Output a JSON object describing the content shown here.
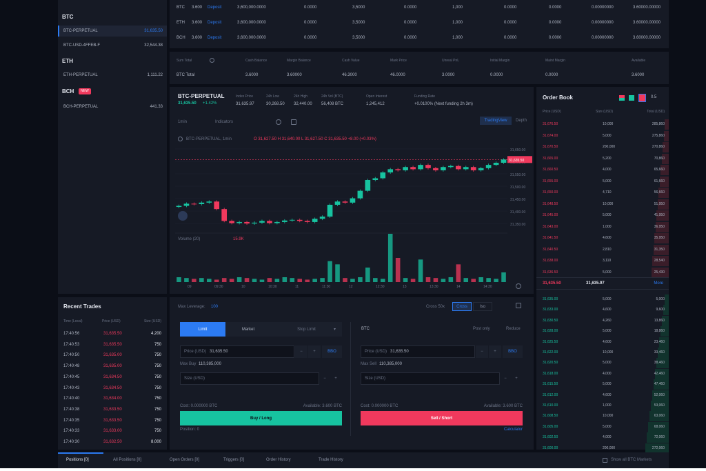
{
  "left_sidebar": {
    "sections": [
      {
        "title": "BTC",
        "items": [
          {
            "name": "BTC-PERPETUAL",
            "value": "31,635.50",
            "active": true
          },
          {
            "name": "BTC-USD-4FFEB-F",
            "value": "32,544.38",
            "active": false
          }
        ]
      },
      {
        "title": "ETH",
        "items": [
          {
            "name": "ETH-PERPETUAL",
            "value": "1,111.22",
            "active": false
          }
        ]
      },
      {
        "title": "BCH",
        "badge": "NEW",
        "items": [
          {
            "name": "BCH-PERPETUAL",
            "value": "441.33",
            "active": false
          }
        ]
      }
    ]
  },
  "top_table": {
    "rows": [
      {
        "asset": "BTC",
        "amount": "3.600",
        "action": "Deposit",
        "v1": "3,600,000.0000",
        "v2": "0.0000",
        "v3": "3,5000",
        "v4": "0.0000",
        "v5": "1,000",
        "v6": "0.0000",
        "v7": "0.0000",
        "v8": "0.00000000",
        "v9": "3.60000.00000"
      },
      {
        "asset": "ETH",
        "amount": "3.600",
        "action": "Deposit",
        "v1": "3,600,000.0000",
        "v2": "0.0000",
        "v3": "3,5000",
        "v4": "0.0000",
        "v5": "1,000",
        "v6": "0.0000",
        "v7": "0.0000",
        "v8": "0.00000000",
        "v9": "3.60000.00000"
      },
      {
        "asset": "BCH",
        "amount": "3.600",
        "action": "Deposit",
        "v1": "3,600,000.0000",
        "v2": "0.0000",
        "v3": "3,5000",
        "v4": "0.0000",
        "v5": "1,000",
        "v6": "0.0000",
        "v7": "0.0000",
        "v8": "0.00000000",
        "v9": "3.60000.00000"
      }
    ]
  },
  "summary": {
    "headers": [
      "Sum Total",
      "Cash Balance",
      "Margin Balance",
      "Cash Value",
      "Mark Price",
      "Unreal PnL",
      "Initial Margin",
      "Maint Margin",
      "Available"
    ],
    "values": [
      "BTC Total",
      "3.6000",
      "3.60000",
      "46.3000",
      "46.0000",
      "3.0000",
      "0.0000",
      "0.0000",
      "3.6000"
    ]
  },
  "ticker": {
    "symbol": "BTC-PERPETUAL",
    "price": "31,635.50",
    "change": "+1.42%",
    "stats": [
      {
        "label": "Index Price",
        "value": "31,635.97"
      },
      {
        "label": "24h Low",
        "value": "30,268.50"
      },
      {
        "label": "24h High",
        "value": "32,440.00"
      },
      {
        "label": "24h Vol (BTC)",
        "value": "56,408 BTC"
      },
      {
        "label": "Open Interest",
        "value": "1,245,412"
      },
      {
        "label": "Funding Rate",
        "value": "+0.0100% (Next funding 2h 3m)"
      }
    ]
  },
  "chart_toolbar": {
    "interval": "1min",
    "type": "Indicators",
    "tradingview": "TradingView",
    "depth": "Depth",
    "ohlc_label": "BTC-PERPETUAL, 1min",
    "ohlc": "O 31,627.50  H 31,640.00  L 31,627.50  C 31,635.50  +8.00 (+0.03%)",
    "price_tag": "31,635.50",
    "volume_label": "Volume (20)",
    "volume_value": "15.9K"
  },
  "chart_data": {
    "type": "line",
    "title": "",
    "xlabel": "",
    "ylabel": "",
    "x": [],
    "x_ticks": [
      "09",
      "09:30",
      "10",
      "10:30",
      "11",
      "11:30",
      "12",
      "12:30",
      "13",
      "13:30",
      "14",
      "14:30"
    ],
    "y_ticks": [
      "31,650.00",
      "31,600.00",
      "31,550.00",
      "31,500.00",
      "31,450.00",
      "31,400.00",
      "31,350.00"
    ],
    "series": [
      {
        "values": [
          31420,
          31430,
          31428,
          31435,
          31440,
          31405,
          31350,
          31340,
          31345,
          31338,
          31342,
          31350,
          31340,
          31345,
          31352,
          31355,
          31350,
          31345,
          31360,
          31370,
          31425,
          31440,
          31435,
          31455,
          31490,
          31540,
          31548,
          31575,
          31590,
          31585,
          31600,
          31590,
          31610,
          31595,
          31585,
          31600,
          31605,
          31590,
          31600,
          31585,
          31595,
          31610,
          31620,
          31635
        ]
      }
    ],
    "volume": [
      6,
      5,
      4,
      5,
      4,
      3,
      5,
      4,
      6,
      5,
      4,
      3,
      5,
      4,
      6,
      5,
      4,
      3,
      4,
      5,
      26,
      22,
      5,
      4,
      6,
      18,
      5,
      4,
      60,
      30,
      5,
      4,
      28,
      6,
      5,
      4,
      6,
      22,
      5,
      4,
      6,
      5,
      4,
      12
    ],
    "ylim": [
      31300,
      31700
    ]
  },
  "order_book": {
    "title": "Order Book",
    "precision": "0.5",
    "headers": [
      "Price (USD)",
      "Size (USD)",
      "Total (USD)"
    ],
    "asks": [
      {
        "price": "31,676.50",
        "size": "10,000",
        "total": "285,860"
      },
      {
        "price": "31,674.00",
        "size": "5,000",
        "total": "275,860"
      },
      {
        "price": "31,670.50",
        "size": "200,000",
        "total": "270,860"
      },
      {
        "price": "31,665.00",
        "size": "5,200",
        "total": "70,860"
      },
      {
        "price": "31,660.50",
        "size": "4,000",
        "total": "65,660"
      },
      {
        "price": "31,655.00",
        "size": "5,000",
        "total": "61,660"
      },
      {
        "price": "31,650.00",
        "size": "4,710",
        "total": "56,660"
      },
      {
        "price": "31,648.50",
        "size": "10,000",
        "total": "51,950"
      },
      {
        "price": "31,645.00",
        "size": "5,000",
        "total": "41,950"
      },
      {
        "price": "31,643.00",
        "size": "1,000",
        "total": "36,950"
      },
      {
        "price": "31,641.50",
        "size": "4,600",
        "total": "35,950"
      },
      {
        "price": "31,640.50",
        "size": "2,810",
        "total": "31,350"
      },
      {
        "price": "31,638.00",
        "size": "3,110",
        "total": "28,540"
      },
      {
        "price": "31,636.50",
        "size": "5,000",
        "total": "25,430"
      }
    ],
    "spread_price": "31,635.50",
    "spread_index": "31,635.97",
    "more": "More",
    "bids": [
      {
        "price": "31,635.00",
        "size": "5,000",
        "total": "5,000"
      },
      {
        "price": "31,633.00",
        "size": "4,600",
        "total": "9,600"
      },
      {
        "price": "31,630.50",
        "size": "4,260",
        "total": "13,860"
      },
      {
        "price": "31,628.00",
        "size": "5,000",
        "total": "18,860"
      },
      {
        "price": "31,625.50",
        "size": "4,600",
        "total": "23,460"
      },
      {
        "price": "31,622.00",
        "size": "10,000",
        "total": "33,460"
      },
      {
        "price": "31,620.50",
        "size": "5,000",
        "total": "38,460"
      },
      {
        "price": "31,618.00",
        "size": "4,000",
        "total": "42,460"
      },
      {
        "price": "31,615.50",
        "size": "5,000",
        "total": "47,460"
      },
      {
        "price": "31,612.00",
        "size": "4,600",
        "total": "52,060"
      },
      {
        "price": "31,610.00",
        "size": "1,000",
        "total": "53,060"
      },
      {
        "price": "31,608.50",
        "size": "10,000",
        "total": "63,060"
      },
      {
        "price": "31,605.00",
        "size": "5,000",
        "total": "68,060"
      },
      {
        "price": "31,602.50",
        "size": "4,000",
        "total": "72,060"
      },
      {
        "price": "31,600.00",
        "size": "200,000",
        "total": "272,060"
      }
    ]
  },
  "recent_trades": {
    "title": "Recent Trades",
    "headers": [
      "Time (Local)",
      "Price (USD)",
      "Size (USD)"
    ],
    "rows": [
      {
        "time": "17:40:56",
        "price": "31,635.50",
        "size": "4,200"
      },
      {
        "time": "17:40:53",
        "price": "31,635.50",
        "size": "750"
      },
      {
        "time": "17:40:50",
        "price": "31,635.00",
        "size": "750"
      },
      {
        "time": "17:40:48",
        "price": "31,635.00",
        "size": "750"
      },
      {
        "time": "17:40:45",
        "price": "31,634.50",
        "size": "750"
      },
      {
        "time": "17:40:43",
        "price": "31,634.50",
        "size": "750"
      },
      {
        "time": "17:40:40",
        "price": "31,634.00",
        "size": "750"
      },
      {
        "time": "17:40:38",
        "price": "31,633.50",
        "size": "750"
      },
      {
        "time": "17:40:35",
        "price": "31,633.50",
        "size": "750"
      },
      {
        "time": "17:40:33",
        "price": "31,633.00",
        "size": "750"
      },
      {
        "time": "17:40:30",
        "price": "31,632.50",
        "size": "8,000"
      }
    ]
  },
  "order_form": {
    "leverage_label": "Max Leverage:",
    "leverage_value": "100",
    "modes": [
      "Cross 50x",
      "Cross",
      "Iso"
    ],
    "tabs": [
      "Limit",
      "Market",
      "Stop Limit"
    ],
    "buy": {
      "header": "BTC",
      "price_label": "Price (USD)",
      "price_value": "31,635.50",
      "size_label": "Max Buy",
      "size_value": "110,385,000",
      "qty_placeholder": "Size (USD)",
      "cost": "Cost: 0.000000 BTC",
      "available": "Available: 3.600  BTC",
      "button": "Buy / Long",
      "position": "Position: 0",
      "bbo": "BBO"
    },
    "sell": {
      "header": "BTC",
      "post_only": "Post only",
      "reduce_only": "Reduce",
      "price_label": "Price (USD)",
      "price_value": "31,635.50",
      "size_label": "Max Sell",
      "size_value": "110,385,000",
      "qty_placeholder": "Size (USD)",
      "cost": "Cost: 0.000000 BTC",
      "available": "Available: 3.600  BTC",
      "button": "Sell / Short",
      "calc": "Calculator",
      "bbo": "BBO"
    }
  },
  "bottom_tabs": {
    "tabs": [
      "Positions [0]",
      "All Positions [0]",
      "Open Orders [0]",
      "Triggers [0]",
      "Order History",
      "Trade History"
    ],
    "right_checkbox": "Show all BTC Markets"
  },
  "colors": {
    "red": "#f0395d",
    "green": "#17c3a0",
    "blue": "#2c7bf3",
    "panel": "#161a25",
    "bg": "#0b0e17"
  }
}
